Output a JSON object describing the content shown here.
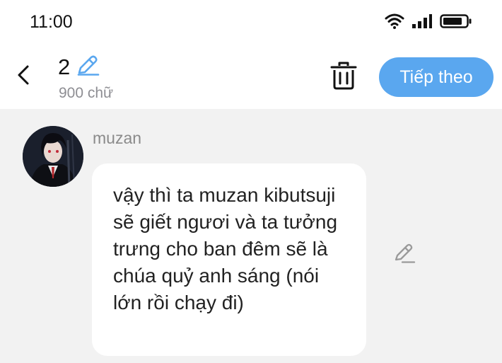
{
  "status_bar": {
    "time": "11:00",
    "icons": [
      "wifi-icon",
      "signal-icon",
      "battery-icon"
    ]
  },
  "header": {
    "title": "2",
    "char_count": "900 chữ",
    "next_label": "Tiếp theo",
    "icons": {
      "back": "chevron-left-icon",
      "edit_title": "pencil-icon",
      "delete": "trash-icon"
    }
  },
  "message": {
    "character_name": "muzan",
    "text": "vậy thì ta muzan kibutsuji sẽ giết ngươi và ta tưởng trưng cho ban đêm sẽ là chúa quỷ anh sáng (nói lớn rồi chạy đi)",
    "edit_icon": "pencil-icon"
  },
  "colors": {
    "accent": "#5aa7ef",
    "background": "#f2f2f2",
    "bubble": "#ffffff",
    "muted_text": "#8a8a8a"
  }
}
